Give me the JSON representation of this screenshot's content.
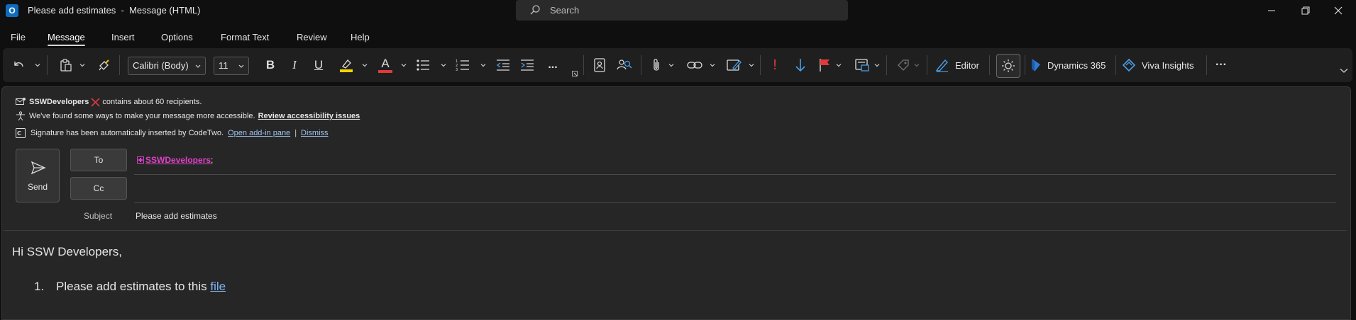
{
  "window": {
    "app_icon_letter": "O",
    "title": "Please add estimates  -  Message (HTML)",
    "search_placeholder": "Search"
  },
  "menu": {
    "tabs": [
      "File",
      "Message",
      "Insert",
      "Options",
      "Format Text",
      "Review",
      "Help"
    ],
    "active_tab": "Message"
  },
  "ribbon": {
    "font_name": "Calibri (Body)",
    "font_size": "11",
    "bold": "B",
    "italic": "I",
    "underline": "U",
    "font_color_letter": "A",
    "more": "...",
    "importance_high": "!",
    "editor_label": "Editor",
    "dynamics_label": "Dynamics 365",
    "viva_label": "Viva Insights",
    "overflow": "···",
    "colors": {
      "highlight": "#f2d600",
      "font_color": "#e03a3a",
      "importance": "#e03a3a",
      "flag": "#e03a3a",
      "low_importance": "#4a9ee8",
      "dynamics": "#2e7bd6"
    }
  },
  "notices": {
    "recipients": {
      "group": "SSWDevelopers",
      "text": "contains about 60 recipients."
    },
    "accessibility": {
      "text": "We've found some ways to make your message more accessible.",
      "link": "Review accessibility issues"
    },
    "signature": {
      "text": "Signature has been automatically inserted by CodeTwo.",
      "link": "Open add-in pane",
      "separator": "|",
      "dismiss": "Dismiss"
    }
  },
  "compose": {
    "send_label": "Send",
    "to_label": "To",
    "cc_label": "Cc",
    "to_recipient": "SSWDevelopers",
    "to_separator": ";",
    "subject_label": "Subject",
    "subject_value": "Please add estimates"
  },
  "body": {
    "greeting": "Hi SSW Developers,",
    "list_number": "1.",
    "list_text": "Please add estimates to this ",
    "list_link": "file"
  }
}
